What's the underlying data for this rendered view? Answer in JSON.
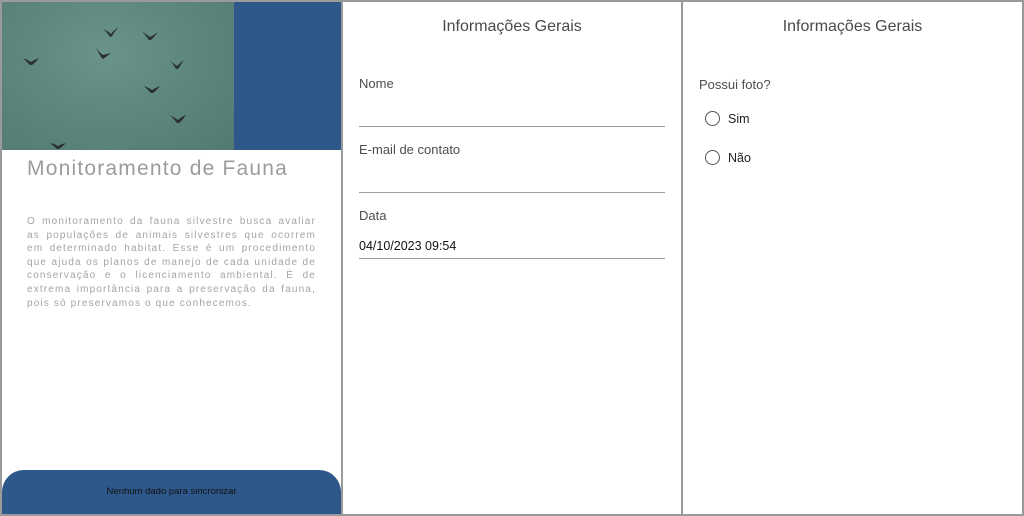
{
  "home": {
    "title": "Monitoramento de Fauna",
    "description": "O monitoramento da fauna silvestre busca avaliar as populações de animais silvestres que ocorrem em determinado habitat. Esse é um procedimento que ajuda os planos de manejo de cada unidade de conservação e o licenciamento ambiental. É de extrema importância para a preservação da fauna, pois só preservamos o que conhecemos.",
    "sync_status": "Nenhum dado para sincronizar",
    "image_icon": "birds-flying-photo",
    "colors": {
      "brand_blue": "#2e578a",
      "photo_teal": "#5e877d"
    }
  },
  "general_info_1": {
    "title": "Informações Gerais",
    "fields": [
      {
        "label": "Nome",
        "value": "",
        "placeholder": ""
      },
      {
        "label": "E-mail de contato",
        "value": "",
        "placeholder": ""
      },
      {
        "label": "Data",
        "value": "04/10/2023 09:54",
        "placeholder": ""
      }
    ]
  },
  "general_info_2": {
    "title": "Informações Gerais",
    "question": "Possui foto?",
    "options": [
      {
        "label": "Sim",
        "selected": false
      },
      {
        "label": "Não",
        "selected": false
      }
    ]
  }
}
